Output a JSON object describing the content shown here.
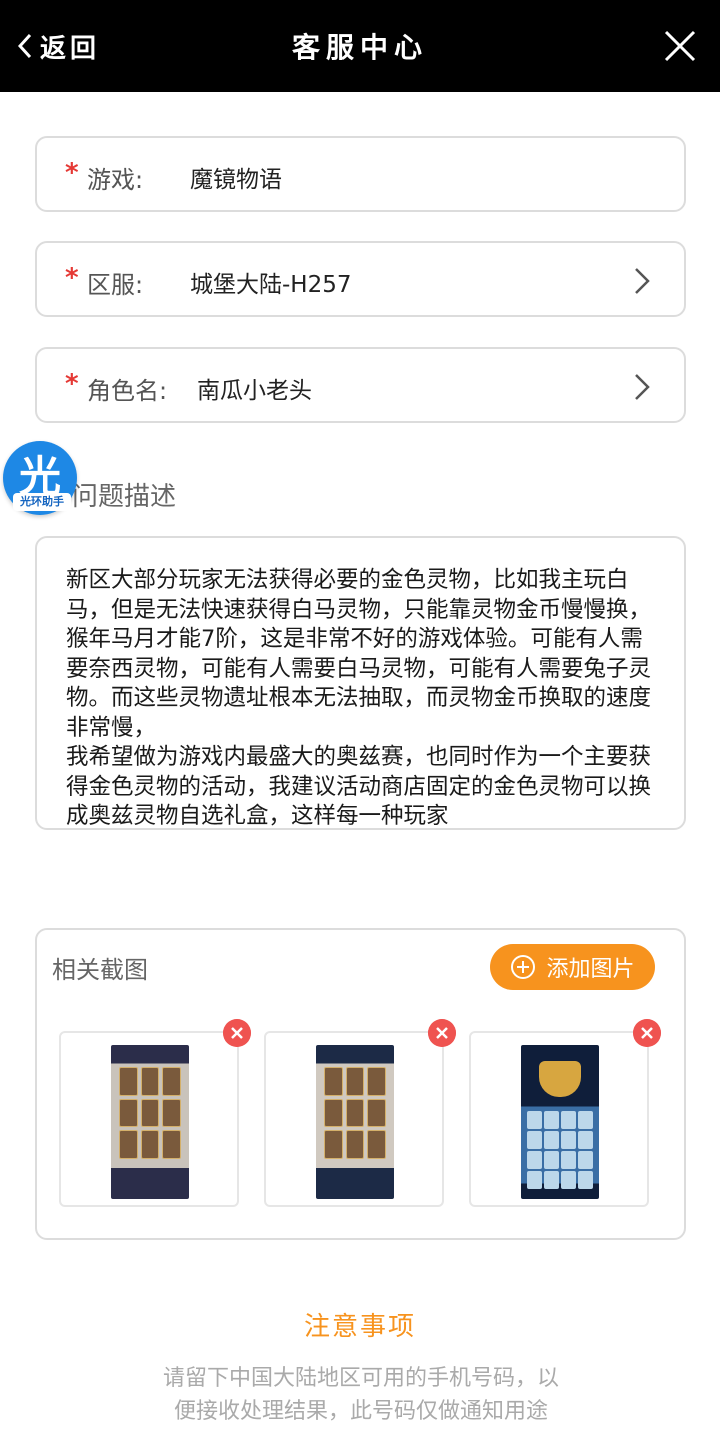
{
  "header": {
    "back_label": "返回",
    "title": "客服中心"
  },
  "form": {
    "game": {
      "label": "游戏:",
      "value": "魔镜物语"
    },
    "server": {
      "label": "区服:",
      "value": "城堡大陆-H257"
    },
    "role": {
      "label": "角色名:",
      "value": "南瓜小老头"
    },
    "required_mark": "*"
  },
  "floating_badge": {
    "glyph": "光",
    "caption": "光环助手"
  },
  "description": {
    "title": "问题描述",
    "text": "新区大部分玩家无法获得必要的金色灵物，比如我主玩白马，但是无法快速获得白马灵物，只能靠灵物金币慢慢换，猴年马月才能7阶，这是非常不好的游戏体验。可能有人需要奈西灵物，可能有人需要白马灵物，可能有人需要兔子灵物。而这些灵物遗址根本无法抽取，而灵物金币换取的速度非常慢，\n我希望做为游戏内最盛大的奥兹赛，也同时作为一个主要获得金色灵物的活动，我建议活动商店固定的金色灵物可以换成奥兹灵物自选礼盒，这样每一种玩家"
  },
  "screenshots": {
    "label": "相关截图",
    "add_button": "添加图片"
  },
  "notice": {
    "title": "注意事项",
    "text": "请留下中国大陆地区可用的手机号码，以便接收处理结果，此号码仅做通知用途"
  },
  "colors": {
    "accent": "#f7931e",
    "required": "#e53935",
    "badge": "#1e88e5"
  }
}
